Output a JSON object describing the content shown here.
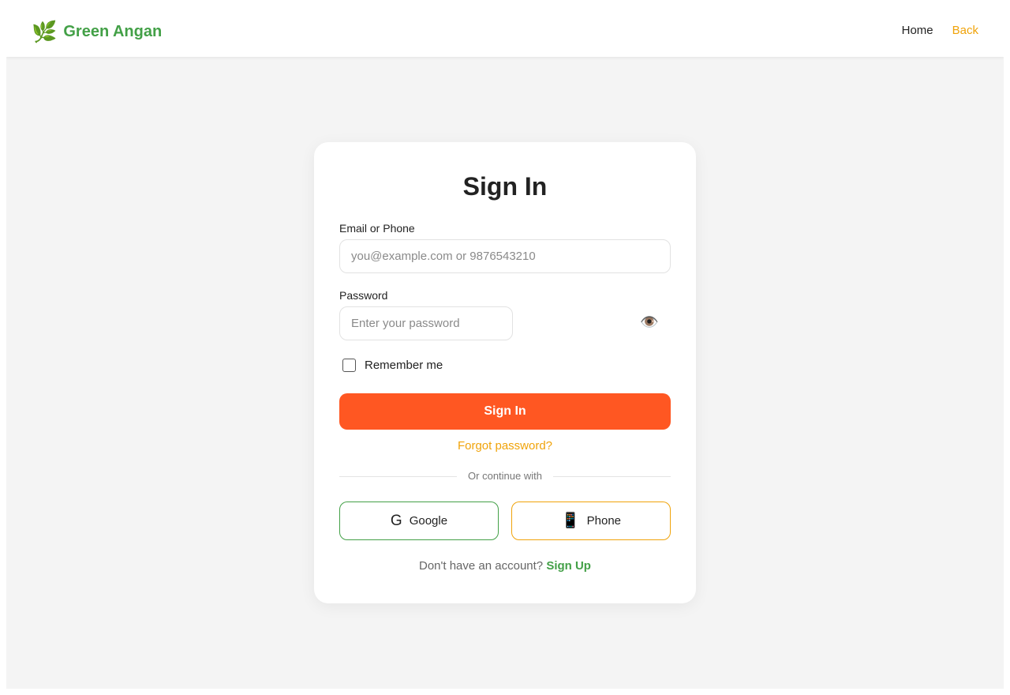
{
  "brand": {
    "icon": "leaf-icon",
    "icon_glyph": "🌿",
    "name": "Green Angan"
  },
  "nav": {
    "home_label": "Home",
    "back_label": "Back"
  },
  "form": {
    "title": "Sign In",
    "email_label": "Email or Phone",
    "email_placeholder": "you@example.com or 9876543210",
    "email_value": "",
    "password_label": "Password",
    "password_placeholder": "Enter your password",
    "password_value": "",
    "password_toggle_icon": "eye-icon",
    "password_toggle_glyph": "👁️",
    "remember_label": "Remember me",
    "remember_checked": false,
    "submit_label": "Sign In",
    "forgot_label": "Forgot password?",
    "divider_text": "Or continue with",
    "social": {
      "google_icon": "google-icon",
      "google_glyph": "G",
      "google_label": "Google",
      "phone_icon": "mobile-phone-icon",
      "phone_glyph": "📱",
      "phone_label": "Phone"
    },
    "signup_prompt": "Don't have an account?",
    "signup_link": "Sign Up"
  },
  "colors": {
    "brand_green": "#43a047",
    "accent_orange": "#ff5722",
    "link_amber": "#f0a30a",
    "page_background": "#f4f4f4",
    "card_background": "#ffffff"
  }
}
